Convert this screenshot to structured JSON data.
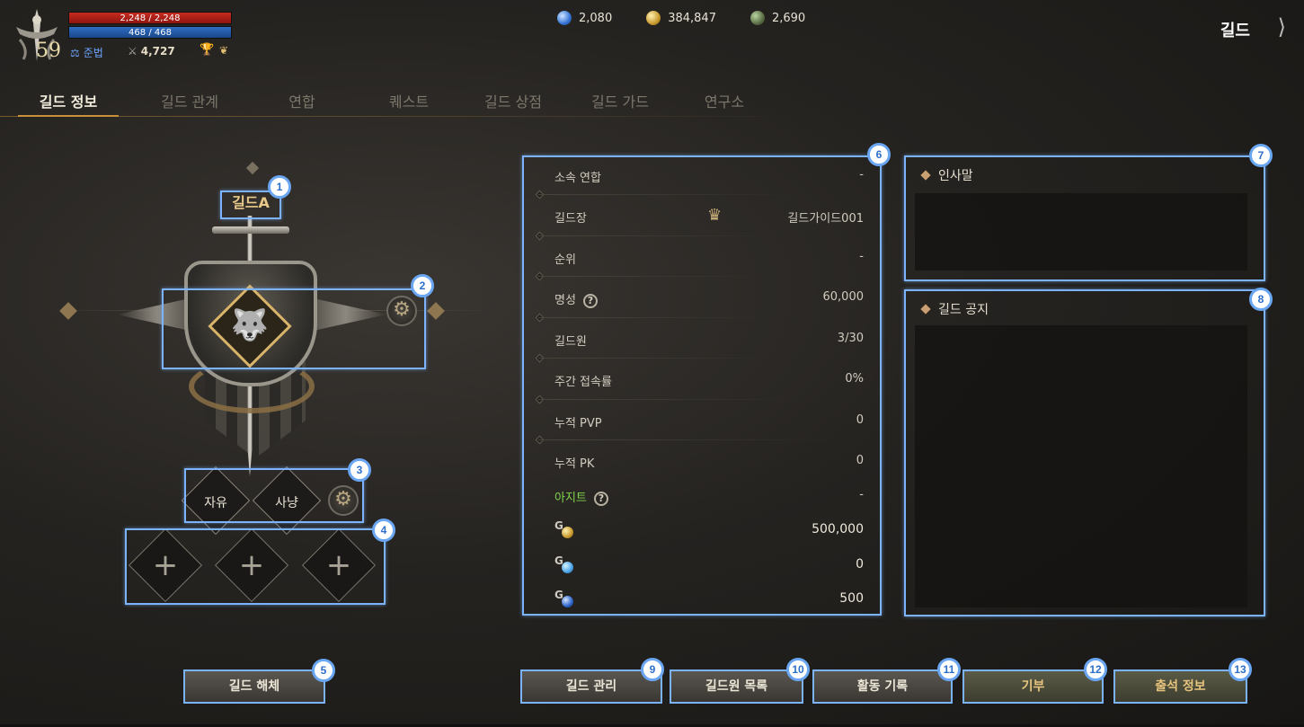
{
  "hud": {
    "level": "59",
    "hp": "2,248 / 2,248",
    "mp": "468 / 468",
    "alignment": "준법",
    "combat_power": "4,727"
  },
  "currencies": [
    {
      "icon": "blue-gem-icon",
      "value": "2,080"
    },
    {
      "icon": "gold-coin-icon",
      "value": "384,847"
    },
    {
      "icon": "green-token-icon",
      "value": "2,690"
    }
  ],
  "menu_title": "길드",
  "tabs": [
    "길드 정보",
    "길드 관계",
    "연합",
    "퀘스트",
    "길드 상점",
    "길드 가드",
    "연구소"
  ],
  "guild": {
    "name": "길드A",
    "tags": [
      "자유",
      "사냥"
    ],
    "add_slots": [
      "+",
      "+",
      "+"
    ]
  },
  "info_rows": [
    {
      "label": "소속 연합",
      "value": "-"
    },
    {
      "label": "길드장",
      "value": "길드가이드001"
    },
    {
      "label": "순위",
      "value": "-"
    },
    {
      "label": "명성",
      "value": "60,000"
    },
    {
      "label": "길드원",
      "value": "3/30"
    },
    {
      "label": "주간 접속률",
      "value": "0%"
    },
    {
      "label": "누적 PVP",
      "value": "0"
    },
    {
      "label": "누적 PK",
      "value": "0"
    },
    {
      "label": "아지트",
      "value": "-"
    }
  ],
  "funds": [
    {
      "prefix": "G",
      "icon": "guild-gold-icon",
      "value": "500,000"
    },
    {
      "prefix": "G",
      "icon": "guild-crystal-icon",
      "value": "0"
    },
    {
      "prefix": "G",
      "icon": "guild-gem-icon",
      "value": "500"
    }
  ],
  "greeting": {
    "title": "인사말"
  },
  "notice": {
    "title": "길드 공지"
  },
  "buttons": {
    "disband": "길드 해체",
    "manage": "길드 관리",
    "members": "길드원 목록",
    "activity": "활동 기록",
    "donate": "기부",
    "attendance": "출석 정보"
  },
  "badges": [
    "1",
    "2",
    "3",
    "4",
    "5",
    "6",
    "7",
    "8",
    "9",
    "10",
    "11",
    "12",
    "13"
  ],
  "colors": {
    "highlight": "#7cb3ff",
    "accent": "#c98f3a",
    "hideout_label": "#7fd44a"
  }
}
